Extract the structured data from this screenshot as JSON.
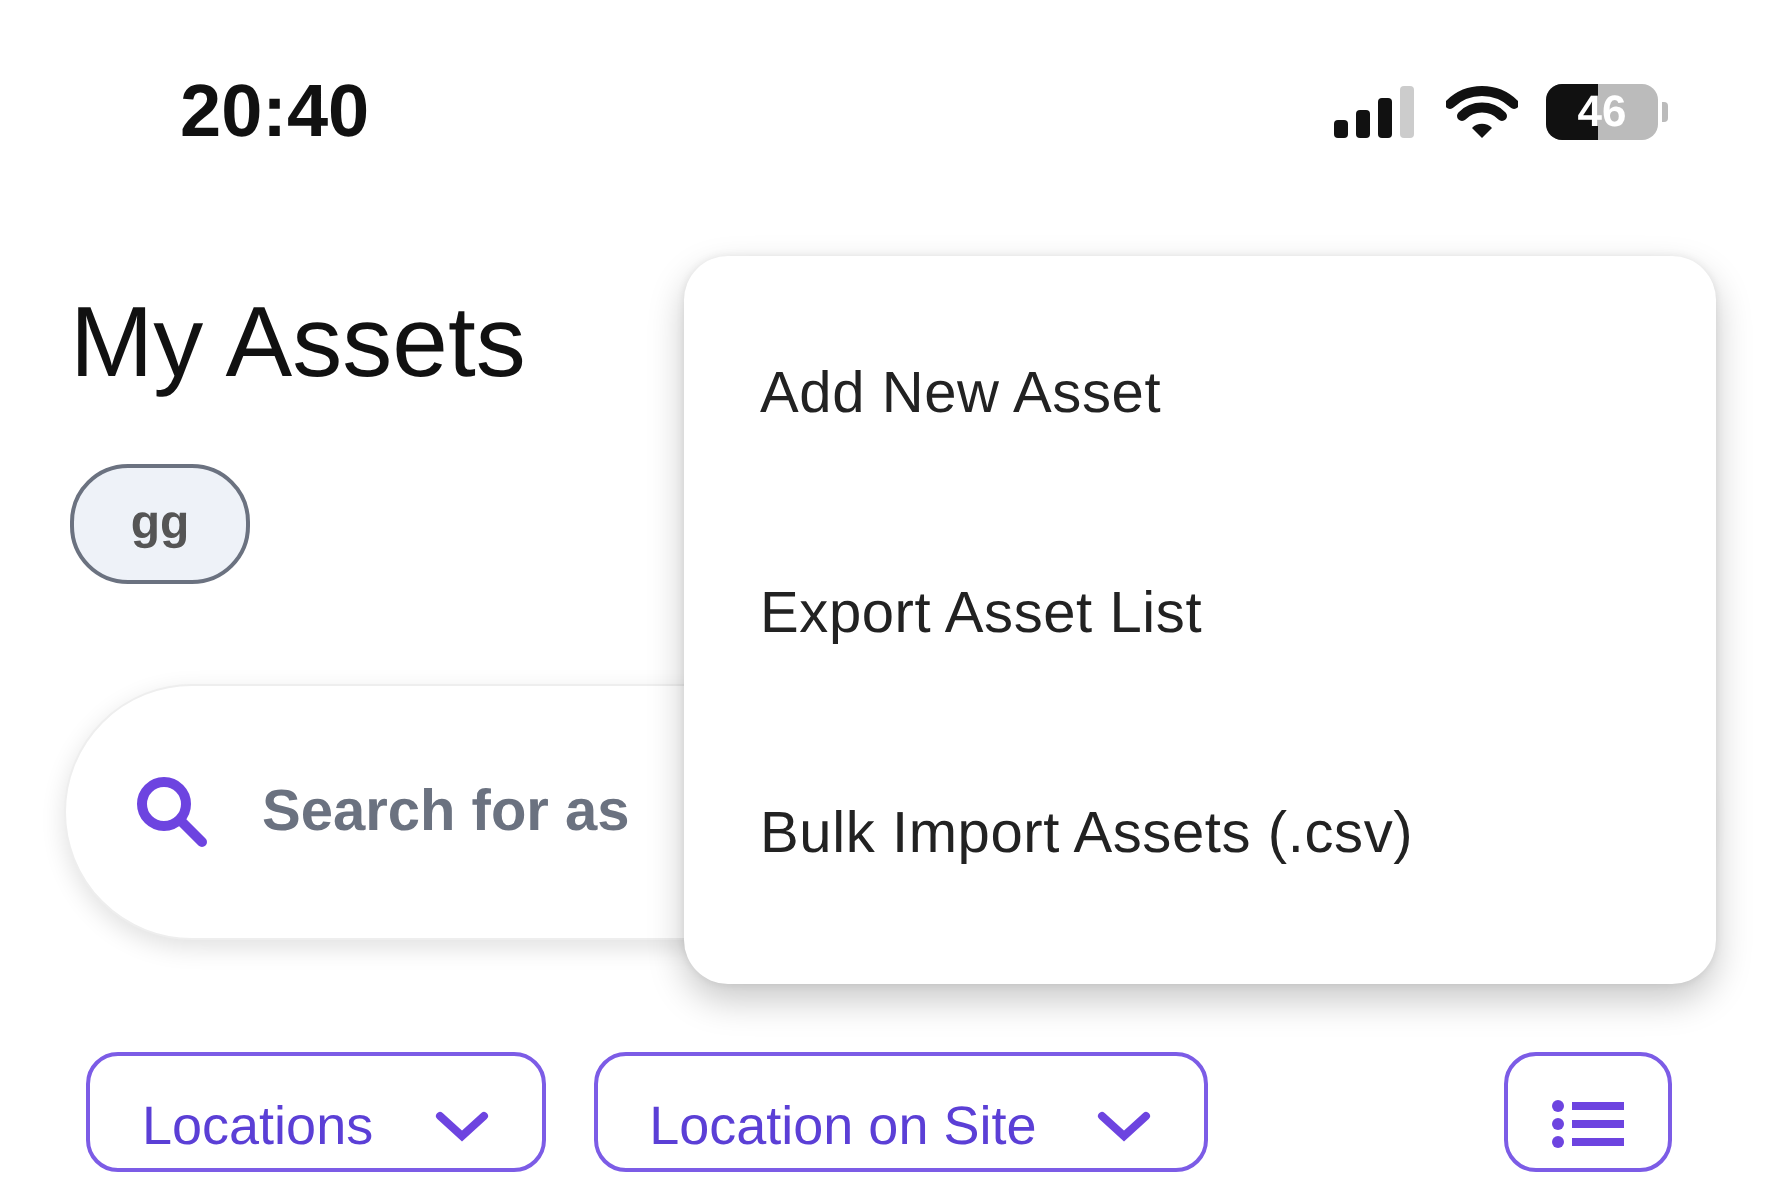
{
  "status_bar": {
    "time": "20:40",
    "battery": "46"
  },
  "header": {
    "title": "My Assets"
  },
  "chips": [
    {
      "label": "gg"
    }
  ],
  "search": {
    "placeholder": "Search for as"
  },
  "filters": [
    {
      "label": "Locations"
    },
    {
      "label": "Location on Site"
    }
  ],
  "menu": {
    "items": [
      {
        "label": "Add New Asset"
      },
      {
        "label": "Export Asset List"
      },
      {
        "label": "Bulk Import Assets (.csv)"
      }
    ]
  }
}
